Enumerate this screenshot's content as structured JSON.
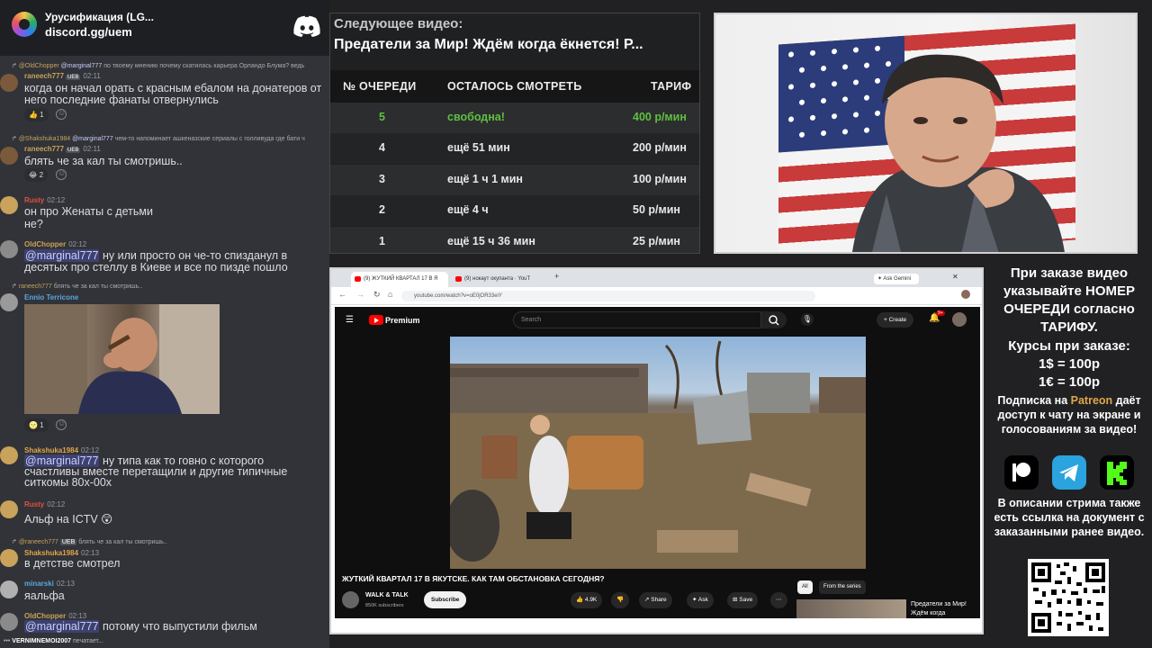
{
  "chat": {
    "server_name": "Урусификация (LG...",
    "server_link": "discord.gg/uem",
    "messages": [
      {
        "reply_name": "@OldChopper",
        "reply_mention": "@marginal777",
        "reply_text": "по твоему мнению почему скатилась карьера Орландо Блума? ведь",
        "user": "raneech777",
        "tag": "UEB",
        "time": "02:11",
        "text": "когда он начал орать с красным ебалом на донатеров от него последние фанаты отвернулись",
        "reaction": "👍 1"
      },
      {
        "reply_name": "@Shakshuka1984",
        "reply_mention": "@marginal777",
        "reply_text": "чем-то напоминает ашкеназские сериалы с голливуда где бати ч",
        "user": "raneech777",
        "tag": "UEB",
        "time": "02:11",
        "text": "блять че за кал ты смотришь..",
        "reaction": "😂 2"
      },
      {
        "user": "Rusty",
        "time": "02:12",
        "text_1": "он про Женаты с детьми",
        "text_2": "не?"
      },
      {
        "user": "OldChopper",
        "time": "02:12",
        "mention": "@marginal777",
        "text_1": " ну или просто он че-то спизданул в",
        "text_2": "десятых про стеллу в Киеве и все по пизде пошло"
      },
      {
        "user": "Ennio Terricone",
        "reply_inline": "raneech777",
        "reply_text": "блять че за кал ты смотришь..",
        "reaction": "🌝 1"
      },
      {
        "user": "Shakshuka1984",
        "time": "02:12",
        "mention": "@marginal777",
        "text_1": " ну типа как то говно с которого",
        "text_2": "счастливы вместе перетащили и другие типичные",
        "text_3": "ситкомы 80х-00х"
      },
      {
        "user": "Rusty",
        "time": "02:12",
        "text": "Альф на ICTV 😲"
      },
      {
        "reply_name": "@raneech777",
        "tag": "UEB",
        "reply_text": "блять че за кал ты смотришь..",
        "user": "Shakshuka1984",
        "time": "02:13",
        "text": "в детстве смотрел"
      },
      {
        "user": "minarski",
        "time": "02:13",
        "text": "яальфа"
      },
      {
        "user": "OldChopper",
        "time": "02:13",
        "mention": "@marginal777",
        "text": " потому что выпустили фильм"
      }
    ],
    "typing_user": "VERNIMNEMOI2007",
    "typing_text": "печатает..."
  },
  "queue": {
    "next_label": "Следующее видео:",
    "next_title": "Предатели за Мир! Ждём когда ёкнется! Р...",
    "headers": [
      "№ ОЧЕРЕДИ",
      "ОСТАЛОСЬ СМОТРЕТЬ",
      "ТАРИФ"
    ],
    "rows": [
      {
        "num": "5",
        "remaining": "свободна!",
        "rate": "400 р/мин",
        "free": true
      },
      {
        "num": "4",
        "remaining": "ещё 51 мин",
        "rate": "200 р/мин",
        "free": false
      },
      {
        "num": "3",
        "remaining": "ещё 1 ч 1 мин",
        "rate": "100 р/мин",
        "free": false
      },
      {
        "num": "2",
        "remaining": "ещё 4 ч",
        "rate": "50 р/мин",
        "free": false
      },
      {
        "num": "1",
        "remaining": "ещё 15 ч 36 мин",
        "rate": "25 р/мин",
        "free": false
      }
    ],
    "free_color": "#5fbf3f"
  },
  "browser": {
    "tab_1": "(9) ЖУТКИЙ КВАРТАЛ 17 В Я",
    "tab_2": "(9) нокаут окупанта · YouT",
    "url": "youtube.com/watch?v=oE0jOR33eiY",
    "ask_gemini": "✦ Ask Gemini",
    "yt_logo": "Premium",
    "search_placeholder": "Search",
    "create": "+ Create",
    "notifications": "9+",
    "video_title": "ЖУТКИЙ КВАРТАЛ 17 В ЯКУТСКЕ. КАК ТАМ ОБСТАНОВКА СЕГОДНЯ?",
    "channel": "WALK & TALK",
    "subscribers": "850K subscribers",
    "subscribe": "Subscribe",
    "likes": "👍 4.9K",
    "dislike": "👎",
    "share": "↗ Share",
    "ask": "✦ Ask",
    "save": "⊞ Save",
    "more": "⋯",
    "chip_all": "All",
    "chip_series": "From the series",
    "side_title": "Предатели за Мир! Ждём когда"
  },
  "info": {
    "order_text": "При заказе видео указывайте НОМЕР ОЧЕРЕДИ согласно ТАРИФУ.",
    "rates_title": "Курсы при заказе:",
    "rate_usd": "1$ = 100р",
    "rate_eur": "1€ = 100р",
    "sub_prefix": "Подписка на ",
    "sub_patreon": "Patreon",
    "sub_suffix": " даёт доступ к чату на экране и голосованиям за видео!",
    "desc": "В описании стрима также есть ссылка на документ с заказанными ранее видео."
  }
}
